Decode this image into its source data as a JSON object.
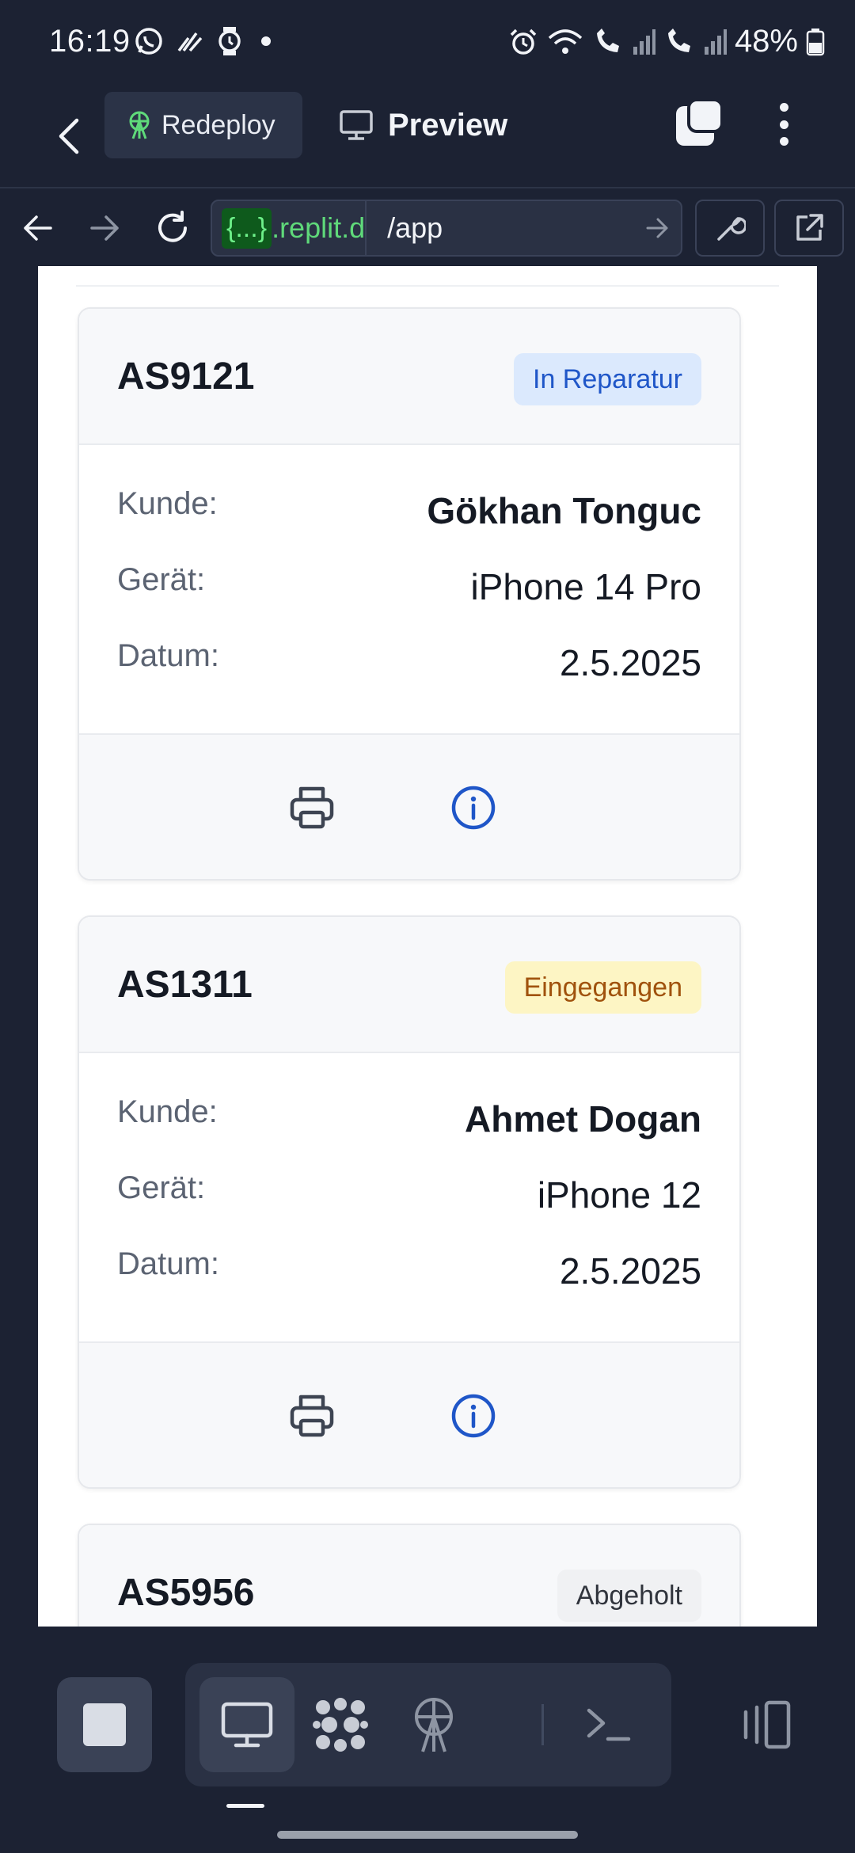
{
  "status_bar": {
    "time": "16:19",
    "battery": "48%",
    "left_icons": [
      "whatsapp-icon",
      "signal-bars-icon",
      "watch-icon",
      "notification-dot-icon"
    ],
    "right_icons": [
      "alarm-icon",
      "wifi-icon",
      "wifi-call-icon",
      "cell-signal-1-icon",
      "wifi-call-2-icon",
      "cell-signal-2-icon",
      "battery-icon"
    ]
  },
  "header": {
    "redeploy_label": "Redeploy",
    "preview_label": "Preview"
  },
  "browser": {
    "url_badge": "{...}",
    "url_host": ".replit.d",
    "url_path": "/app"
  },
  "cards": [
    {
      "id": "AS9121",
      "status": "In Reparatur",
      "status_color": "#1f56c8",
      "customer_label": "Kunde:",
      "customer": "Gökhan Tonguc",
      "device_label": "Gerät:",
      "device": "iPhone 14 Pro",
      "date_label": "Datum:",
      "date": "2.5.2025"
    },
    {
      "id": "AS1311",
      "status": "Eingegangen",
      "status_color": "#a0520d",
      "customer_label": "Kunde:",
      "customer": "Ahmet Dogan",
      "device_label": "Gerät:",
      "device": "iPhone 12",
      "date_label": "Datum:",
      "date": "2.5.2025"
    },
    {
      "id": "AS5956",
      "status": "Abgeholt",
      "status_color": "#30343c"
    }
  ],
  "bottom_toolbar": {
    "items": [
      "stop-icon",
      "preview-monitor-icon",
      "apps-grid-icon",
      "deploy-antenna-icon",
      "terminal-icon",
      "panels-icon"
    ]
  },
  "colors": {
    "app_bg": "#1c2233",
    "accent_blue": "#1f56c8",
    "replit_green": "#5fd97a"
  }
}
